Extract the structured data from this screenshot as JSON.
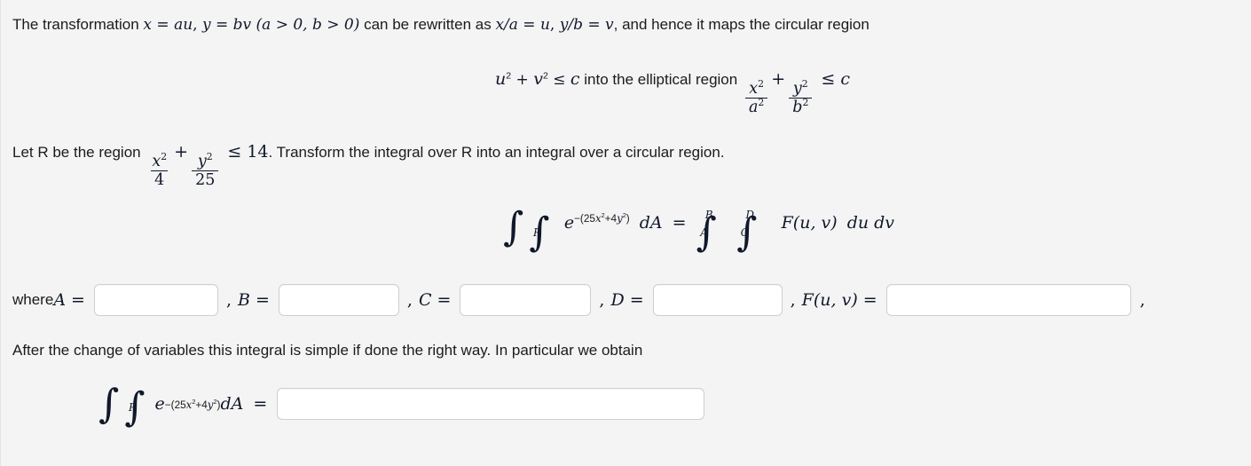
{
  "page": {
    "background_color": "#f4f4f4",
    "text_color": "#1b1b1b",
    "math_color": "#10182a"
  },
  "intro": {
    "t1": "The transformation ",
    "m1": "x",
    "eq1": " = ",
    "m2": "au",
    "comma1": ", ",
    "m3": "y",
    "eq2": " = ",
    "m4": "bv",
    "cond": " (a > 0, b > 0)",
    "t2": " can be rewritten as ",
    "m5": "x/a",
    "eq3": " = ",
    "m6": "u",
    "comma2": ", ",
    "m7": "y/b",
    "eq4": " = ",
    "m8": "v",
    "t3": ", and hence it maps the circular region"
  },
  "maps": {
    "lhs_u": "u",
    "lhs_plus": " + ",
    "lhs_v": "v",
    "lhs_le": " ≤ ",
    "lhs_c": "c",
    "mid_text": " into the elliptical region ",
    "frac1_num": "x",
    "frac1_den": "a",
    "plus": "+",
    "frac2_num": "y",
    "frac2_den": "b",
    "le": "≤",
    "rhs_c": "c",
    "exp": "2"
  },
  "region": {
    "prefix": "Let R be the region ",
    "frac1_num": "x",
    "frac1_den": "4",
    "plus": "+",
    "frac2_num": "y",
    "frac2_den": "25",
    "le": "≤",
    "value": "14",
    "suffix": ". Transform the integral over R into an integral over a circular region.",
    "exp": "2"
  },
  "equation": {
    "int_sign": "∫",
    "sub_R": "R",
    "e": "e",
    "exponent": "−(25x²+4y²)",
    "exponent_parts": {
      "minus": "−(25",
      "x": "x",
      "x_pow": "2",
      "plus": "+4",
      "y": "y",
      "y_pow": "2",
      "close": ")"
    },
    "dA": "dA",
    "equals": "=",
    "limit_A": "A",
    "limit_B": "B",
    "limit_C": "C",
    "limit_D": "D",
    "integrand": "F(u, v)",
    "differentials": "du dv"
  },
  "where_row": {
    "lead": "where ",
    "label_A": "A",
    "label_B": "B",
    "label_C": "C",
    "label_D": "D",
    "label_F": "F(u, v)",
    "equals": "=",
    "comma": ",",
    "trailing_comma": ",",
    "input_A_value": "",
    "input_B_value": "",
    "input_C_value": "",
    "input_D_value": "",
    "input_F_value": "",
    "placeholder": ""
  },
  "after": {
    "text": "After the change of variables this integral is simple if done the right way. In particular we obtain"
  },
  "final": {
    "int_sign": "∫",
    "sub_R": "R",
    "e": "e",
    "exponent_parts": {
      "minus": "−(25",
      "x": "x",
      "x_pow": "2",
      "plus": "+4",
      "y": "y",
      "y_pow": "2",
      "close": ")"
    },
    "dA": "dA",
    "equals": "=",
    "input_value": "",
    "placeholder": ""
  }
}
